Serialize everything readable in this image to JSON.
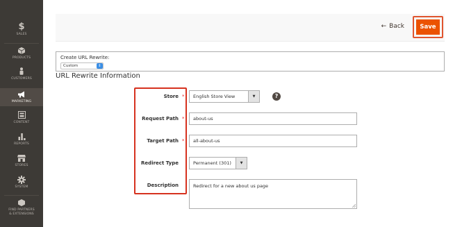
{
  "sidebar": {
    "items": [
      {
        "label": "SALES",
        "icon": "dollar-icon"
      },
      {
        "label": "PRODUCTS",
        "icon": "cube-icon"
      },
      {
        "label": "CUSTOMERS",
        "icon": "person-icon"
      },
      {
        "label": "MARKETING",
        "icon": "megaphone-icon"
      },
      {
        "label": "CONTENT",
        "icon": "content-icon"
      },
      {
        "label": "REPORTS",
        "icon": "bar-chart-icon"
      },
      {
        "label": "STORES",
        "icon": "store-icon"
      },
      {
        "label": "SYSTEM",
        "icon": "gear-icon"
      },
      {
        "label": "FIND PARTNERS\n& EXTENSIONS",
        "icon": "box-icon"
      }
    ],
    "active": "MARKETING",
    "dollar_glyph": "$"
  },
  "header": {
    "back_label": "Back",
    "back_arrow": "←",
    "save_label": "Save"
  },
  "create": {
    "label": "Create URL Rewrite:",
    "selected": "Custom",
    "spin_glyph": "⇕"
  },
  "section_title": "URL Rewrite Information",
  "form": {
    "store": {
      "label": "Store",
      "value": "English Store View",
      "help": "?"
    },
    "request_path": {
      "label": "Request Path",
      "value": "about-us"
    },
    "target_path": {
      "label": "Target Path",
      "value": "all-about-us"
    },
    "redirect_type": {
      "label": "Redirect Type",
      "value": "Permanent (301)"
    },
    "description": {
      "label": "Description",
      "value": "Redirect for a new about us page"
    },
    "required_mark": "*",
    "caret": "▼"
  },
  "colors": {
    "sidebar_bg": "#3d3a36",
    "save_bg": "#eb5202",
    "highlight": "#d6311e",
    "required": "#e22626"
  }
}
